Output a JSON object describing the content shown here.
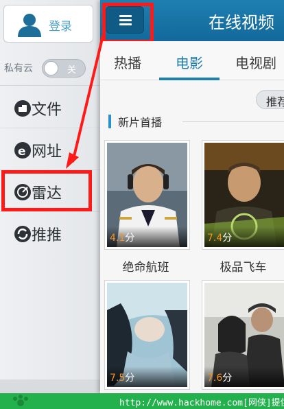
{
  "sidebar": {
    "login_label": "登录",
    "cloud_label": "私有云",
    "cloud_toggle_state": "关",
    "items": [
      {
        "label": "文件",
        "icon": "file-icon"
      },
      {
        "label": "网址",
        "icon": "ie-browser-icon"
      },
      {
        "label": "雷达",
        "icon": "radar-icon"
      },
      {
        "label": "推推",
        "icon": "push-icon"
      }
    ]
  },
  "header": {
    "title": "在线视频",
    "menu_icon": "hamburger-menu-icon"
  },
  "tabs": [
    {
      "label": "热播"
    },
    {
      "label": "电影",
      "active": true
    },
    {
      "label": "电视剧"
    }
  ],
  "recommend_label": "推荐",
  "section": {
    "title": "新片首播"
  },
  "movies": [
    {
      "title": "绝命航班",
      "score": "4.1",
      "unit": "分"
    },
    {
      "title": "极品飞车",
      "score": "7.4",
      "unit": "分"
    },
    {
      "title": "",
      "score": "7.5",
      "unit": "分"
    },
    {
      "title": "",
      "score": "7.6",
      "unit": "分"
    }
  ],
  "watermark": {
    "text": "http://www.hackhome.com[网侠]提供"
  },
  "colors": {
    "accent": "#1f7fb1",
    "highlight": "#ff1a1a",
    "score": "#f7931e",
    "watermark_bg": "#22b14c"
  }
}
